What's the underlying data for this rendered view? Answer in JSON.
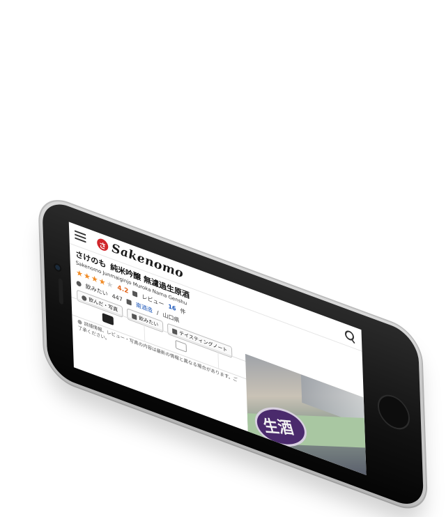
{
  "app": {
    "logo_mark": "さ",
    "logo_text": "Sakenomo"
  },
  "sake": {
    "title_prefix": "さけのも",
    "title": "純米吟醸 無濾過生原酒",
    "romaji": "Sakenomo Junmaiginjo Muroka Nama Genshu",
    "rating": "4.2",
    "want_to_drink_label": "飲みたい",
    "want_to_drink_count": "447",
    "review_label": "レビュー",
    "review_count": "16",
    "review_unit": "件",
    "brewery": "南酒造",
    "region": "山口県",
    "stars_filled": 4,
    "stars_total": 5
  },
  "actions": {
    "drank_label": "飲んだ・写真",
    "want_label": "飲みたい",
    "tasting_label": "テイスティングノート"
  },
  "notice": "詳細情報、レビュー・写真の内容は最新の情報と異なる場合があります。ご了承ください。",
  "photo": {
    "label_text": "生酒"
  },
  "colors": {
    "accent_red": "#d1262b",
    "star_orange": "#f08a24",
    "link_blue": "#1a55b8"
  }
}
